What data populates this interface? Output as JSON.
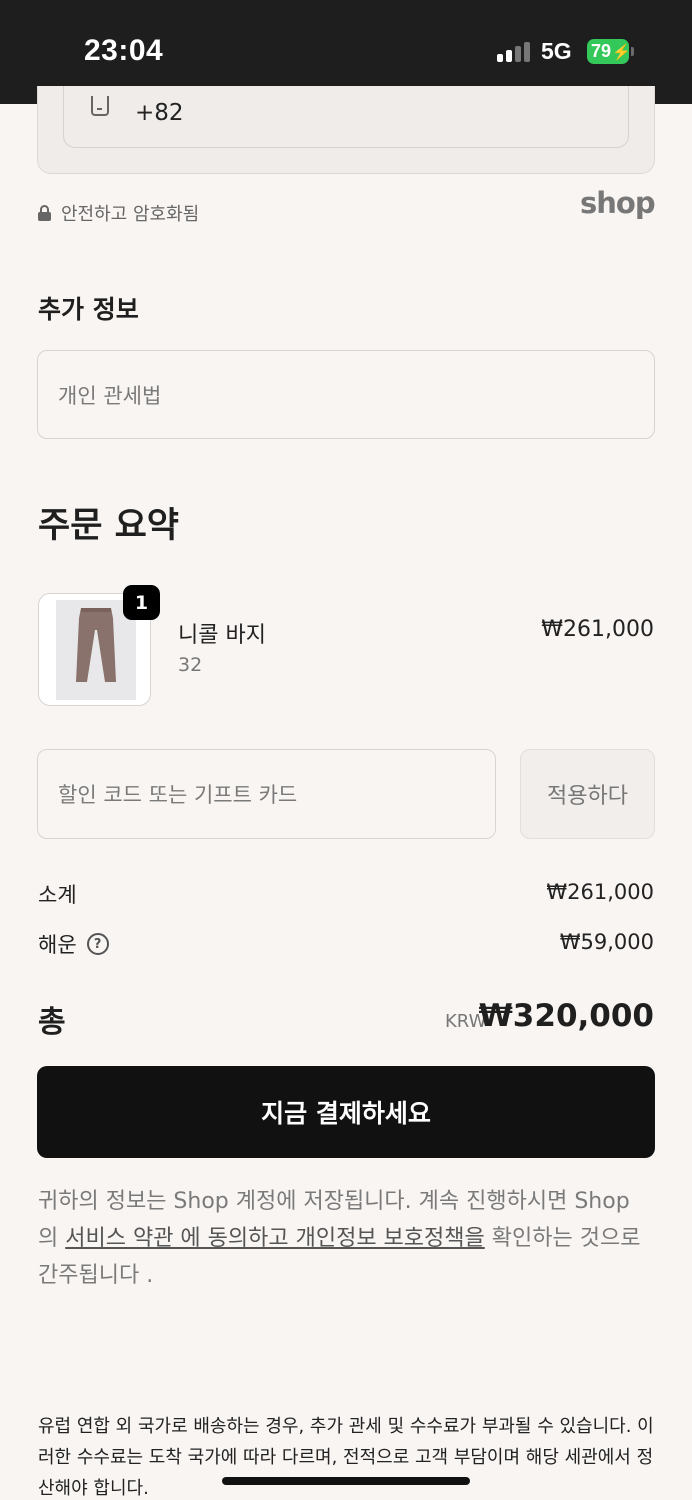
{
  "status_bar": {
    "time": "23:04",
    "network": "5G",
    "battery": "79"
  },
  "contact": {
    "phone_value": "+82"
  },
  "security": {
    "secure_text": "안전하고 암호화됨",
    "shop_logo": "shop"
  },
  "additional_info": {
    "heading": "추가 정보",
    "customs_placeholder": "개인 관세법"
  },
  "order_summary": {
    "heading": "주문 요약",
    "product": {
      "name": "니콜 바지",
      "variant": "32",
      "price": "₩261,000",
      "quantity": "1"
    },
    "discount": {
      "placeholder": "할인 코드 또는 기프트 카드",
      "apply_label": "적용하다"
    },
    "subtotal": {
      "label": "소계",
      "value": "₩261,000"
    },
    "shipping": {
      "label": "해운",
      "value": "₩59,000"
    },
    "total": {
      "label": "총",
      "currency": "KRW",
      "value": "₩320,000"
    }
  },
  "pay_button_label": "지금 결제하세요",
  "consent": {
    "part1": "귀하의 정보는 Shop 계정에 저장됩니다. 계속 진행하시면 Shop 의 ",
    "terms_link": "서비스 약관 에 동의하고 개인정보 보호정책을",
    "part2": " 확인하는 것으로 간주됩니다 ."
  },
  "eu_notice": "유럽 연합 외 국가로 배송하는 경우, 추가 관세 및 수수료가 부과될 수 있습니다. 이러한 수수료는 도착 국가에 따라 다르며, 전적으로 고객 부담이며 해당 세관에서 정산해야 합니다.",
  "colors": {
    "background": "#f9f5f3",
    "primary_button": "#111111",
    "battery_green": "#34c759"
  }
}
